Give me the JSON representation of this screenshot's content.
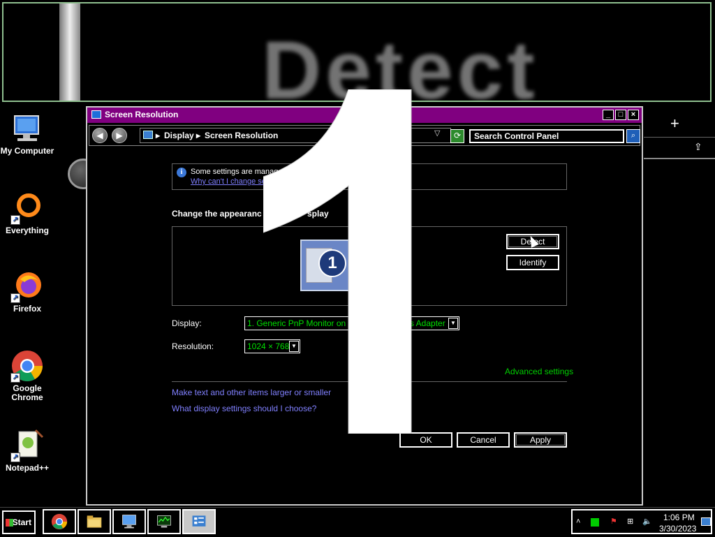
{
  "banner": {
    "magnified_text": "Detect"
  },
  "desktop": {
    "icons": [
      {
        "label": "My Computer"
      },
      {
        "label": "Everything"
      },
      {
        "label": "Firefox"
      },
      {
        "label": "Google Chrome"
      },
      {
        "label": "Notepad++"
      }
    ]
  },
  "window": {
    "title": "Screen Resolution",
    "controls": {
      "minimize": "_",
      "maximize": "□",
      "close": "×"
    },
    "breadcrumb": [
      "Display",
      "Screen Resolution"
    ],
    "search_placeholder": "Search Control Panel",
    "info": {
      "text": "Some settings are manag",
      "link": "Why can't I change se"
    },
    "heading_left": "Change the appearanc",
    "heading_right": "splay",
    "monitor_number": "1",
    "buttons": {
      "detect": "Detect",
      "identify": "Identify",
      "ok": "OK",
      "cancel": "Cancel",
      "apply": "Apply"
    },
    "display_label": "Display:",
    "display_value": "1. Generic PnP Monitor on Sta",
    "display_value_tail": "s Adapter",
    "resolution_label": "Resolution:",
    "resolution_value": "1024 × 768",
    "advanced_settings": "Advanced settings",
    "links": {
      "text_size": "Make text and other items larger or smaller",
      "what_settings": "What display settings should I choose?"
    }
  },
  "overlay": {
    "big_number": "1"
  },
  "right_panel": {
    "plus": "+",
    "share": "⇪"
  },
  "taskbar": {
    "start": "Start",
    "clock_time": "1:06 PM",
    "clock_date": "3/30/2023"
  },
  "colors": {
    "titlebar": "#800080",
    "accent_green": "#00d000",
    "link_blue": "#8080ff"
  }
}
